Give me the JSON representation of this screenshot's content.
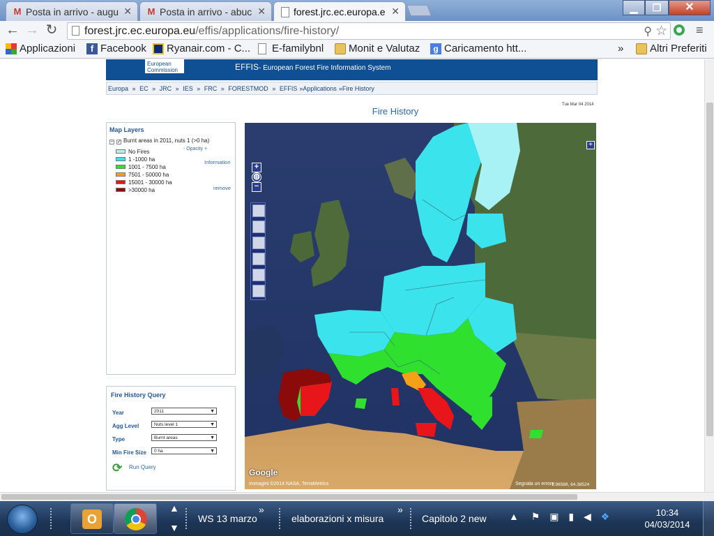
{
  "browser": {
    "tabs": [
      {
        "label": "Posta in arrivo - augu",
        "icon": "gmail-icon"
      },
      {
        "label": "Posta in arrivo - abuc",
        "icon": "gmail-icon"
      },
      {
        "label": "forest.jrc.ec.europa.e",
        "icon": "page-icon"
      }
    ],
    "url_host": "forest.jrc.ec.europa.eu",
    "url_path": "/effis/applications/fire-history/",
    "bookmarks": [
      {
        "label": "Applicazioni",
        "icon": "apps-icon"
      },
      {
        "label": "Facebook",
        "icon": "facebook-icon"
      },
      {
        "label": "Ryanair.com - C...",
        "icon": "ryanair-icon"
      },
      {
        "label": "E-familybnl",
        "icon": "page-icon"
      },
      {
        "label": "Monit e Valutaz",
        "icon": "folder-icon"
      },
      {
        "label": "Caricamento htt...",
        "icon": "google-icon"
      }
    ],
    "overflow_label": "»",
    "other_bookmarks": "Altri Preferiti"
  },
  "site": {
    "logo_line1": "European",
    "logo_line2": "Commission",
    "banner_title": "EFFIS",
    "banner_subtitle": "- European Forest Fire Information System",
    "breadcrumbs": [
      "Europa",
      "»",
      "EC",
      "»",
      "JRC",
      "»",
      "IES",
      "»",
      "FRC",
      "»",
      "FORESTMOD",
      "»",
      "EFFIS",
      "»Applications",
      "»Fire History"
    ],
    "page_title": "Fire History",
    "date": "Tue Mar 04 2014"
  },
  "layers": {
    "title": "Map Layers",
    "layer_name": "Burnt areas in 2011, nuts 1 (>0 ha)",
    "opacity_label": "- Opacity +",
    "information_label": "Information",
    "remove_label": "remove",
    "legend": [
      {
        "label": "No Fires",
        "color": "#b8f0f0"
      },
      {
        "label": "1 -1000 ha",
        "color": "#3be3ec"
      },
      {
        "label": "1001 - 7500 ha",
        "color": "#2fe02f"
      },
      {
        "label": "7501 - 50000 ha",
        "color": "#f4a117"
      },
      {
        "label": "15001 - 30000 ha",
        "color": "#e8161b"
      },
      {
        "label": ">30000 ha",
        "color": "#8b0a0a"
      }
    ]
  },
  "query": {
    "title": "Fire History Query",
    "fields": [
      {
        "label": "Year",
        "value": "2011"
      },
      {
        "label": "Agg Level",
        "value": "Nuts level 1"
      },
      {
        "label": "Type",
        "value": "Burnt areas"
      },
      {
        "label": "Min Fire Size",
        "value": "0 ha"
      }
    ],
    "run_label": "Run Query"
  },
  "map": {
    "attribution": "Immagini ©2014 NASA, TerraMetrics",
    "report_label": "Segnala un errore",
    "coords": "1.96588, 64.38524",
    "google_label": "Google"
  },
  "taskbar": {
    "windows": [
      {
        "label": "WS 13 marzo"
      },
      {
        "label": "elaborazioni x misura"
      },
      {
        "label": "Capitolo 2 new"
      }
    ],
    "time": "10:34",
    "date": "04/03/2014"
  }
}
